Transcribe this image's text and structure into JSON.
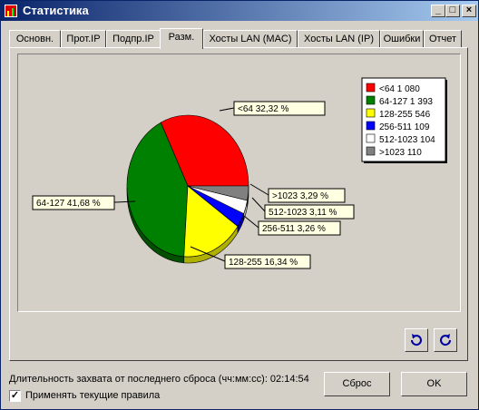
{
  "window": {
    "title": "Статистика"
  },
  "tabs": [
    {
      "label": "Основн."
    },
    {
      "label": "Прот.IP"
    },
    {
      "label": "Подпр.IP"
    },
    {
      "label": "Разм."
    },
    {
      "label": "Хосты LAN (MAC)"
    },
    {
      "label": "Хосты LAN (IP)"
    },
    {
      "label": "Ошибки"
    },
    {
      "label": "Отчет"
    }
  ],
  "active_tab": "Разм.",
  "chart_data": {
    "type": "pie",
    "slices": [
      {
        "name": "<64",
        "value": 1080,
        "percent": 32.32,
        "color": "#ff0000",
        "legend": "<64  1 080",
        "label": "<64  32,32 %"
      },
      {
        "name": "64-127",
        "value": 1393,
        "percent": 41.68,
        "color": "#008000",
        "legend": "64-127  1 393",
        "label": "64-127  41,68 %"
      },
      {
        "name": "128-255",
        "value": 546,
        "percent": 16.34,
        "color": "#ffff00",
        "legend": "128-255  546",
        "label": "128-255  16,34 %"
      },
      {
        "name": "256-511",
        "value": 109,
        "percent": 3.26,
        "color": "#0000ff",
        "legend": "256-511  109",
        "label": "256-511  3,26 %"
      },
      {
        "name": "512-1023",
        "value": 104,
        "percent": 3.11,
        "color": "#ffffff",
        "legend": "512-1023  104",
        "label": "512-1023  3,11 %"
      },
      {
        "name": ">1023",
        "value": 110,
        "percent": 3.29,
        "color": "#808080",
        "legend": ">1023  110",
        "label": ">1023  3,29 %"
      }
    ]
  },
  "status": {
    "text": "Длительность захвата от последнего сброса (чч:мм:сс): 02:14:54"
  },
  "checkbox": {
    "label": "Применять текущие правила",
    "checked": "✓"
  },
  "buttons": {
    "reset": "Сброс",
    "ok": "OK"
  },
  "icons": {
    "refresh": "refresh-icon",
    "refresh_ccw": "refresh-ccw-icon"
  }
}
